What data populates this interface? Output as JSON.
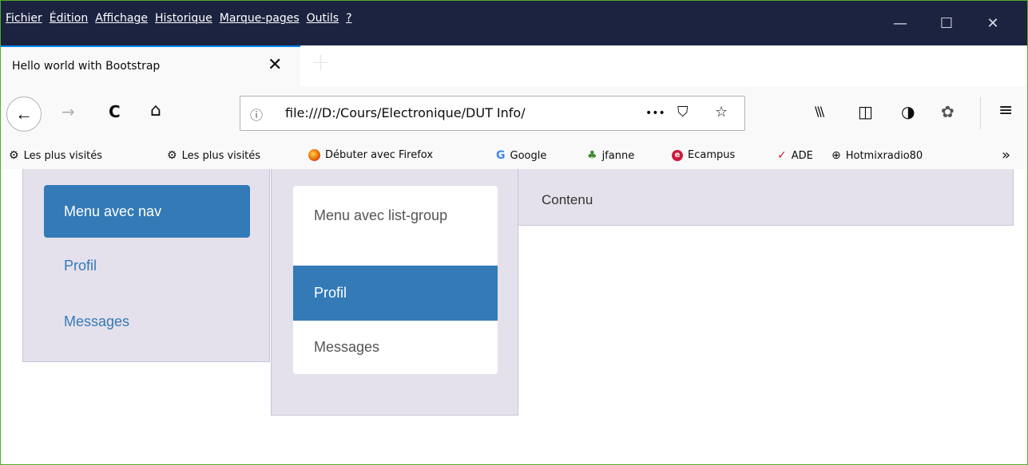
{
  "menubar": {
    "items": [
      "Fichier",
      "Édition",
      "Affichage",
      "Historique",
      "Marque-pages",
      "Outils",
      "?"
    ]
  },
  "window_controls": {
    "minimize_glyph": "—",
    "maximize_glyph": "☐",
    "close_glyph": "✕"
  },
  "tab": {
    "title": "Hello world with Bootstrap",
    "close_glyph": "✕",
    "new_tab_glyph": "+"
  },
  "toolbar": {
    "back_glyph": "←",
    "forward_glyph": "→",
    "reload_glyph": "C",
    "home_glyph": "⌂",
    "url_info_glyph": "ⓘ",
    "url": "file:///D:/Cours/Electronique/DUT Info/",
    "page_actions_glyph": "•••",
    "pocket_glyph": "⛉",
    "star_glyph": "☆",
    "library_glyph": "\\\\\\",
    "sidebar_glyph": "◫",
    "extension1_glyph": "◑",
    "extension2_glyph": "✿",
    "menu_glyph": "≡"
  },
  "bookmarks": {
    "items": [
      {
        "label": "Les plus visités",
        "icon": "gear-icon"
      },
      {
        "label": "Les plus visités",
        "icon": "gear-icon"
      },
      {
        "label": "Débuter avec Firefox",
        "icon": "firefox-icon"
      },
      {
        "label": "Google",
        "icon": "google-icon"
      },
      {
        "label": "jfanne",
        "icon": "tree-icon"
      },
      {
        "label": "Ecampus",
        "icon": "ecampus-icon"
      },
      {
        "label": "ADE",
        "icon": "check-icon"
      },
      {
        "label": "Hotmixradio80",
        "icon": "globe-icon"
      }
    ],
    "more_glyph": "»"
  },
  "page": {
    "nav": {
      "active_label": "Menu avec nav",
      "links": [
        "Profil",
        "Messages"
      ]
    },
    "list_group": {
      "items": [
        "Menu avec list-group",
        "Profil",
        "Messages"
      ],
      "active_index": 1
    },
    "content_label": "Contenu"
  },
  "colors": {
    "titlebar": "#1c2340",
    "tab_accent": "#0a84ff",
    "bootstrap_primary": "#337ab7",
    "column_background": "#e5e1ec"
  }
}
